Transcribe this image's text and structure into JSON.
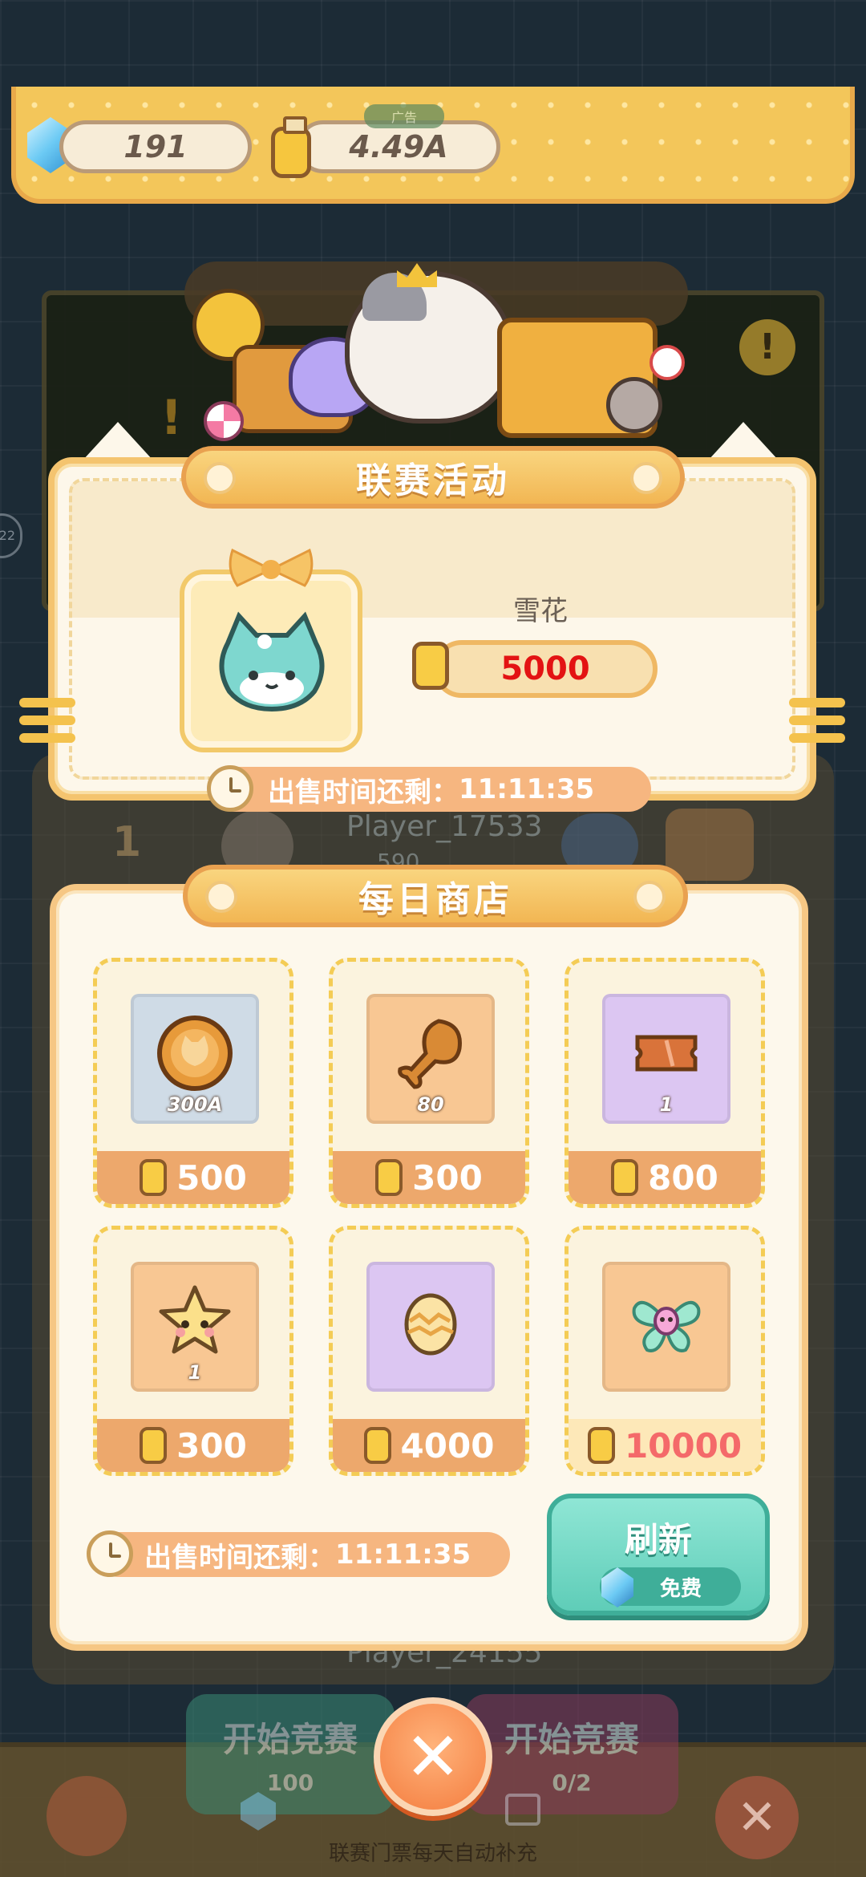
{
  "top_bar": {
    "gems": "191",
    "coins": "4.49A",
    "ad_label": "广告"
  },
  "background": {
    "rank": "1",
    "player_name": "Player_17533",
    "player_score": "590",
    "player_name_2": "Player_24155",
    "side_badge": "22",
    "start_match_label": "开始竞赛",
    "start_match_cost": "100",
    "start_match_video_label": "开始竞赛",
    "video_count": "0/2",
    "ticket_note": "联赛门票每天自动补充"
  },
  "league_event": {
    "title": "联赛活动",
    "item_name": "雪花",
    "price": "5000",
    "price_color": "#e31313",
    "timer_label": "出售时间还剩：",
    "timer_value": "11:11:35"
  },
  "daily_shop": {
    "title": "每日商店",
    "items": [
      {
        "icon": "cat-coin-icon",
        "qty": "300A",
        "price": "500",
        "bg": "#cfdbe6"
      },
      {
        "icon": "drumstick-icon",
        "qty": "80",
        "price": "300",
        "bg": "#f8c793"
      },
      {
        "icon": "ticket-icon",
        "qty": "1",
        "price": "800",
        "bg": "#dcc6f2"
      },
      {
        "icon": "star-icon",
        "qty": "1",
        "price": "300",
        "bg": "#f8c793"
      },
      {
        "icon": "egg-icon",
        "qty": "",
        "price": "4000",
        "bg": "#dcc6f2"
      },
      {
        "icon": "butterfly-icon",
        "qty": "",
        "price": "10000",
        "bg": "#f8c793"
      }
    ],
    "timer_label": "出售时间还剩：",
    "timer_value": "11:11:35",
    "refresh_label": "刷新",
    "refresh_cost": "免费"
  },
  "colors": {
    "accent_orange": "#f6b680",
    "panel_border": "#f4c46f",
    "refresh_green": "#5fcdb8",
    "close_orange": "#f47d3f"
  }
}
